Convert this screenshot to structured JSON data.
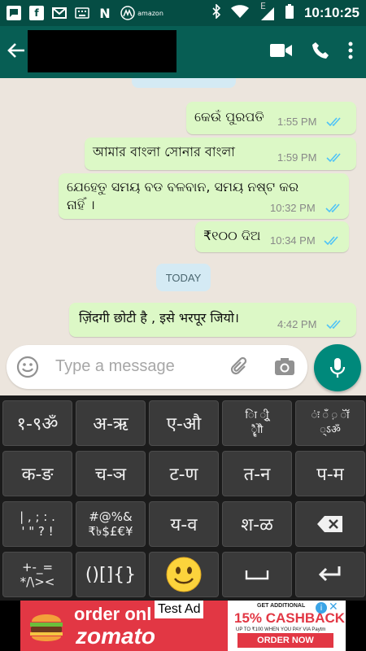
{
  "status_bar": {
    "time": "10:10:25",
    "network_label": "E",
    "left_icons": [
      "chat-bubble-icon",
      "facebook-icon",
      "gmail-icon",
      "keyboard-icon",
      "n-icon",
      "motorola-icon",
      "amazon-icon"
    ],
    "right_icons": [
      "bluetooth-icon",
      "wifi-icon",
      "signal-icon",
      "battery-icon"
    ]
  },
  "header": {
    "icons": [
      "back-arrow-icon",
      "video-call-icon",
      "phone-icon",
      "more-vert-icon"
    ],
    "colors": {
      "header": "#075e54",
      "status": "#054d44"
    }
  },
  "chat": {
    "messages": [
      {
        "text": "କେଉଁ ପୁରପତି",
        "time": "1:55 PM",
        "status": "read"
      },
      {
        "text": "আমার বাংলা সোনার বাংলা",
        "time": "1:59 PM",
        "status": "read"
      },
      {
        "text_line1": "ଯେହେତୁ ସମୟ ବଡ ବଳବାନ, ସମୟ ନଷ୍ଟ କର",
        "text_line2": "ନାହିଁ ।",
        "time": "10:32 PM",
        "status": "read"
      },
      {
        "text": "₹୧୦୦ ଦିଅ",
        "time": "10:34 PM",
        "status": "read"
      },
      {
        "text": "ज़िंदगी छोटी है , इसे भरपूर जियो।",
        "time": "4:42 PM",
        "status": "read"
      }
    ],
    "date_separator": "TODAY",
    "colors": {
      "outgoing_bubble": "#dcf8c6",
      "background": "#ece5dd",
      "read_ticks": "#4fc3f7"
    }
  },
  "compose": {
    "placeholder": "Type a message",
    "icons": [
      "emoji-icon",
      "attach-icon",
      "camera-icon",
      "mic-icon"
    ],
    "mic_color": "#00897b"
  },
  "keyboard": {
    "rows": [
      [
        "१-९ॐ",
        "अ-ऋ",
        "ए-औ",
        "ा ि ी ु ू ृ ॄ ॢ ॣ े ै ो ौ",
        "ं ः ँ ़ ॅ ॉ ् ऽ ॐ"
      ],
      [
        "क-ङ",
        "च-ञ",
        "ट-ण",
        "त-न",
        "प-म"
      ],
      [
        "| , ; : . ' \" ? !",
        "#@%& ₹৳$£€¥",
        "य-व",
        "श-ळ",
        "backspace"
      ],
      [
        "+-_= */\\><",
        "()[]{}",
        "emoji",
        "space",
        "enter"
      ]
    ],
    "row1_key4_line1": "ाि ीुू",
    "row1_key4_line2": "ृॄेैोौ",
    "row1_key5_line1": "ंः ँ ़ ॅॉ",
    "row1_key5_line2": "्ऽॐ",
    "row3_key1_line1": "| , ; : .",
    "row3_key1_line2": "' \" ? !",
    "row3_key2_line1": "#@%&",
    "row3_key2_line2": "₹৳$£€¥",
    "row4_key1_line1": "+-_=",
    "row4_key1_line2": "*/\\><"
  },
  "ad": {
    "order_text": "order onl",
    "brand": "zomato",
    "test_label": "Test Ad",
    "line1": "GET ADDITIONAL",
    "headline": "15% CASHBACK",
    "line3": "UP TO ₹100 WHEN YOU PAY VIA Paytm",
    "cta": "ORDER NOW",
    "info": "i",
    "close": "✕"
  }
}
